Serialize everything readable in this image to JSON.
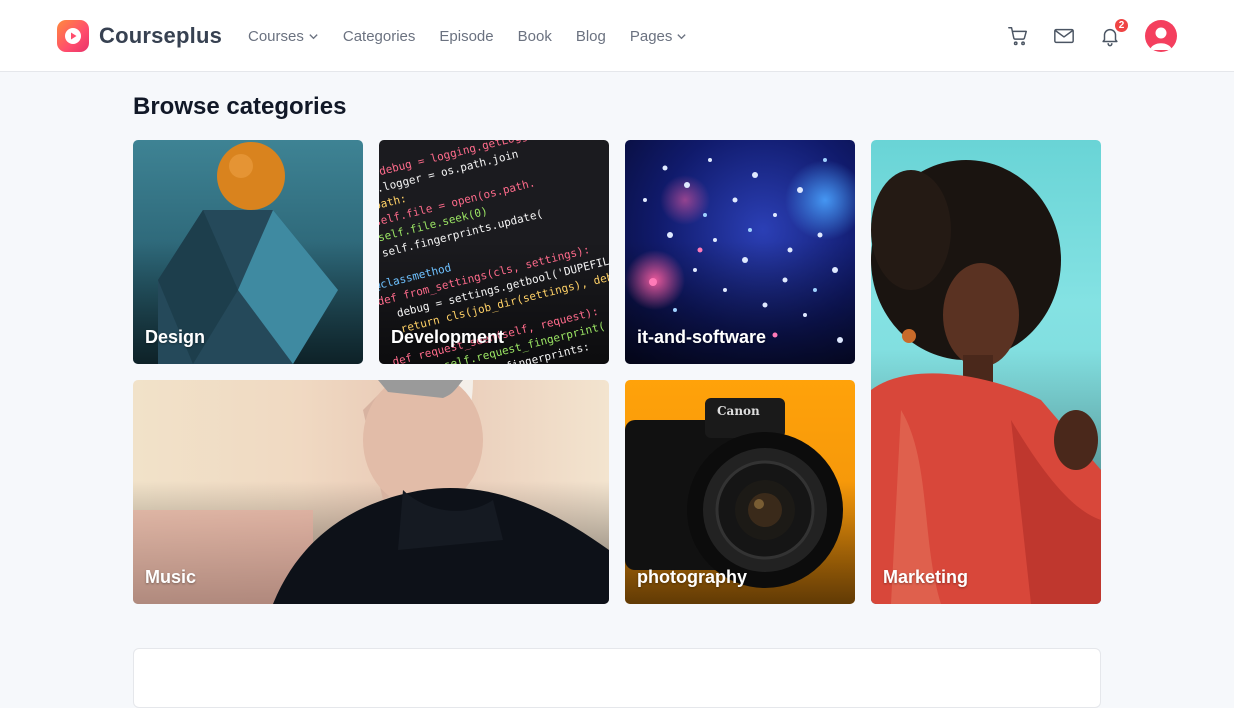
{
  "brand": {
    "name": "Courseplus",
    "accent": "#ff4d6d"
  },
  "nav": {
    "items": [
      {
        "label": "Courses",
        "has_dropdown": true
      },
      {
        "label": "Categories",
        "has_dropdown": false
      },
      {
        "label": "Episode",
        "has_dropdown": false
      },
      {
        "label": "Book",
        "has_dropdown": false
      },
      {
        "label": "Blog",
        "has_dropdown": false
      },
      {
        "label": "Pages",
        "has_dropdown": true
      }
    ]
  },
  "header_actions": {
    "icons": [
      "cart-icon",
      "mail-icon",
      "bell-icon"
    ],
    "notification_count": "2"
  },
  "main": {
    "title": "Browse categories",
    "categories": [
      {
        "label": "Design"
      },
      {
        "label": "Development"
      },
      {
        "label": "it-and-software"
      },
      {
        "label": "Marketing"
      },
      {
        "label": "Music"
      },
      {
        "label": "photography"
      }
    ]
  },
  "colors": {
    "badge": "#ef4444",
    "avatar": "#f43f5e"
  }
}
